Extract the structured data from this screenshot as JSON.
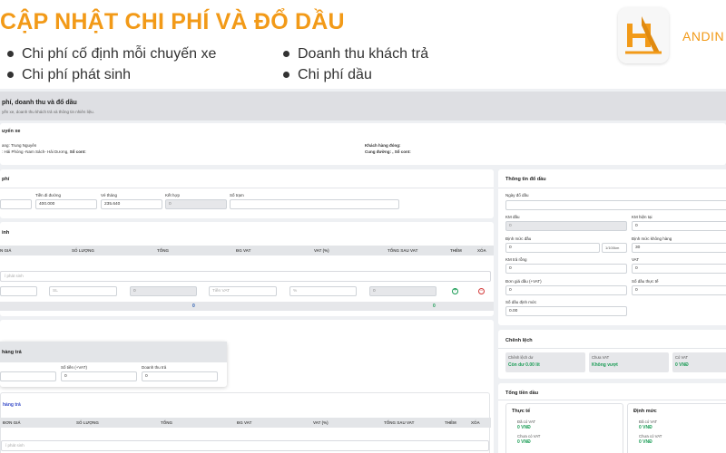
{
  "banner": {
    "title": "CẬP NHẬT CHI PHÍ VÀ ĐỔ DẦU",
    "bullets_left": [
      "Chi phí cố định mỗi chuyến xe",
      "Chi phí phát sinh"
    ],
    "bullets_right": [
      "Doanh thu khách trả",
      "Chi phí dầu"
    ],
    "brand": "ANDIN",
    "brand_color": "#f29a18"
  },
  "page": {
    "title": "phí, doanh thu và đổ dầu",
    "subtitle": "yến xe, doanh thu khách trả và thông tin nhiên liệu."
  },
  "trip": {
    "title": "uyến xe",
    "driver_label": "ang:",
    "driver_value": "Trung Nguyên",
    "route_label": ":",
    "route_value": "Hải Phòng -Nam Sách- Hải Dương,",
    "cont_label": "Số cont:",
    "customer_label": "Khách hàng đóng:",
    "route2_label": "Cung đường:",
    "cont2_label": ", Số cont:"
  },
  "fixed_cost": {
    "title": "phí",
    "fields": [
      {
        "label": "",
        "value": ""
      },
      {
        "label": "Tiền đi đường",
        "value": "400.000"
      },
      {
        "label": "Vé tháng",
        "value": "235.640"
      },
      {
        "label": "Kết hợp",
        "value": "0"
      },
      {
        "label": "Số trạm",
        "value": ""
      }
    ]
  },
  "extra_cost": {
    "title": "inh",
    "columns": [
      "N GIÁ",
      "SỐ LƯỢNG",
      "TỔNG",
      "ĐG VAT",
      "VAT (%)",
      "TỔNG SAU VAT",
      "THÊM",
      "XÓA"
    ],
    "placeholder": "í phát sinh",
    "row_inputs": [
      "",
      "SL",
      "0",
      "Tiền VAT",
      "%",
      "0"
    ],
    "totals": [
      "0",
      "0"
    ],
    "add_icon": "+",
    "delete_icon": "−"
  },
  "revenue": {
    "title": "",
    "popup_title": "hàng trả",
    "popup_fields": [
      {
        "label": "",
        "value": ""
      },
      {
        "label": "Số tiền (+VAT)",
        "value": "0"
      },
      {
        "label": "Doanh thu trả",
        "value": "0"
      }
    ],
    "link": "hàng trả",
    "columns": [
      "ĐƠN GIÁ",
      "SỐ LƯỢNG",
      "TỔNG",
      "ĐG VAT",
      "VAT (%)",
      "TỔNG SAU VAT",
      "THÊM",
      "XÓA"
    ],
    "placeholder": "í phát sinh"
  },
  "fuel": {
    "title": "Thông tin đổ dầu",
    "date_label": "Ngày đổ dầu",
    "date_value": "",
    "km_start_label": "KM đầu",
    "km_start_value": "0",
    "km_now_label": "KM hiện tại",
    "km_now_value": "0",
    "norm_label": "Định mức đầu",
    "norm_value": "0",
    "norm_unit": "1/100km",
    "norm_empty_label": "Định mức không hàng",
    "norm_empty_value": "30",
    "km_empty_label": "KM trả rỗng",
    "km_empty_value": "0",
    "vat_label": "VAT",
    "vat_value": "0",
    "unit_price_label": "Đơn giá dầu (+VAT)",
    "unit_price_value": "0",
    "actual_label": "Số dầu thực tế",
    "actual_value": "0",
    "norm_fuel_label": "Số dầu định mức",
    "norm_fuel_value": "0.00"
  },
  "diff": {
    "title": "Chênh lệch",
    "tiles": [
      {
        "label": "Chênh lệch dư",
        "value": "Còn dư 0.00 lít"
      },
      {
        "label": "Chưa VAT",
        "value": "Không vượt"
      },
      {
        "label": "Có VAT",
        "value": "0 VNĐ"
      }
    ]
  },
  "fuel_money": {
    "title": "Tổng tiền dầu",
    "actual": {
      "title": "Thực tế",
      "l1": "Đã có VAT",
      "v1": "0 VNĐ",
      "l2": "Chưa có VAT",
      "v2": "0 VNĐ"
    },
    "norm": {
      "title": "Định mức",
      "l1": "Đã có VAT",
      "v1": "0 VNĐ",
      "l2": "Chưa có VAT",
      "v2": "0 VNĐ"
    }
  }
}
